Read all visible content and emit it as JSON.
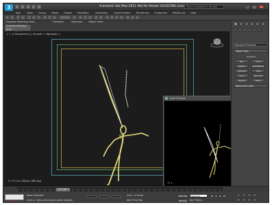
{
  "app": {
    "title": "Autodesk 3ds Max 2011   Not for Resale   GhOSTING.max",
    "logo": "3",
    "search_placeholder": "Type a keyword or phrase",
    "window_buttons": [
      "_",
      "□",
      "X"
    ]
  },
  "menu": [
    "Edit",
    "Tools",
    "Group",
    "Views",
    "Create",
    "Modifiers",
    "Animation",
    "Graph Editors",
    "Rendering",
    "Customize",
    "MAXScript",
    "Help"
  ],
  "ribbon": {
    "tabs": [
      "Graphite Modeling Tools",
      "Freeform",
      "Selection",
      "Object Paint"
    ],
    "panel_rows": [
      "Graphite Modeling Tools",
      "Polygon Modeling"
    ]
  },
  "viewport": {
    "label": "[ + ] [ Perspective ] [ Smooth + Highlights ]",
    "stats": "3: 77.1 fx: 298 px (380 dpi)"
  },
  "float_window": {
    "title": "Layer Preview",
    "close": "x",
    "frame_label": "77.1"
  },
  "command_panel": {
    "dropdown": "Standard Primitives",
    "object_type_header": "Object Type",
    "autogrid": "AutoGrid",
    "primitives": [
      "Box",
      "Cone",
      "Sphere",
      "GeoSphere",
      "Cylinder",
      "Tube",
      "Torus",
      "Pyramid",
      "Teapot",
      "Plane"
    ],
    "name_color_header": "Name and Color"
  },
  "timeline": {
    "thumb": "77 / 100"
  },
  "status": {
    "maxscript": "Welcome to M",
    "line1": "None Selected",
    "line2": "Click or click-and-drag to select objects",
    "grid": "Grid = 0.0mm",
    "add_time_tag": "Add Time Tag",
    "auto_key": "Auto Key",
    "selected": "Selected",
    "set_key": "Set Key",
    "key_filters": "Key Filters..."
  },
  "colors": {
    "viewport_bg": "#1c1c1c",
    "figure": "#e9e07a",
    "wing": "#0d0d0d",
    "frame_outer": "#4c8a95",
    "frame_mid": "#4d8e5a",
    "frame_inner": "#a88a3e",
    "accent": "#1e9ad6"
  }
}
